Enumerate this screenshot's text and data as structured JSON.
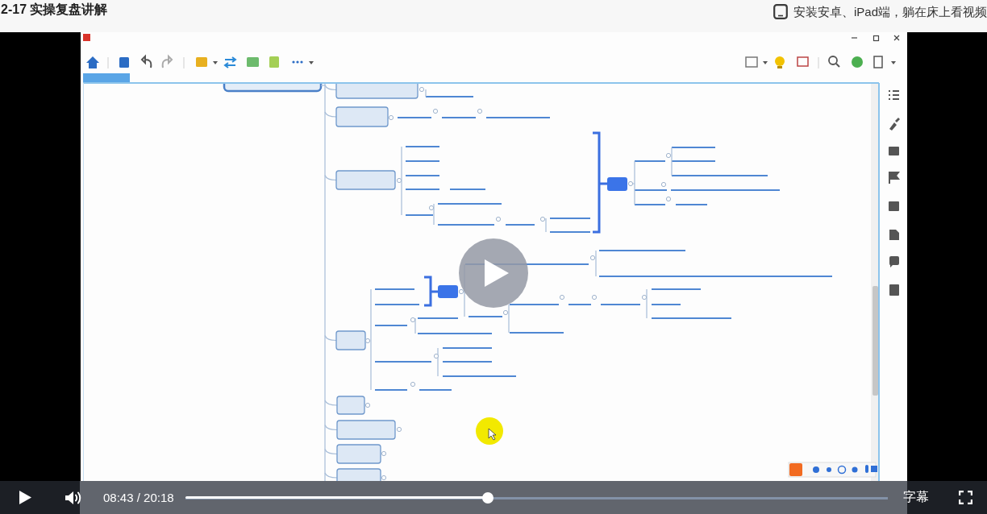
{
  "header": {
    "title": "2-17 实操复盘讲解",
    "app_promo": "安装安卓、iPad端，躺在床上看视频"
  },
  "player": {
    "paused": true,
    "time": "08:43 / 20:18",
    "progress": {
      "level": 0.43
    },
    "subtitles": "字幕"
  }
}
